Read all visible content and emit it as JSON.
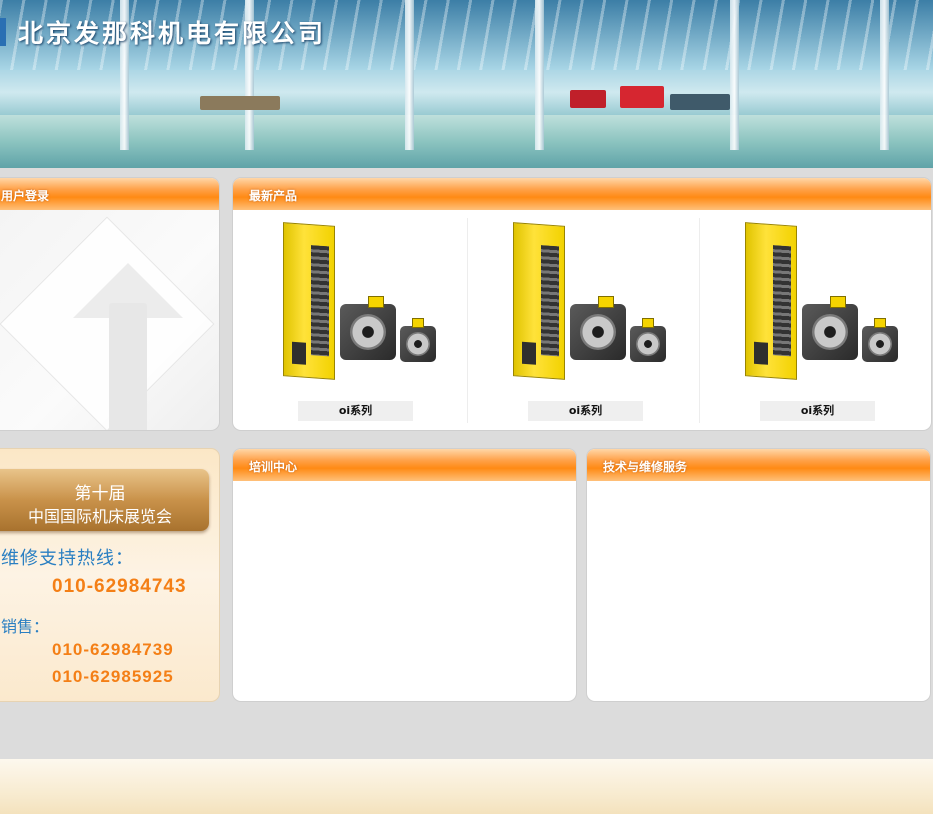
{
  "banner": {
    "company_name": "北京发那科机电有限公司"
  },
  "login_panel": {
    "title": "用户登录"
  },
  "products_panel": {
    "title": "最新产品",
    "items": [
      {
        "caption": "oi系列",
        "image": "servo-drive-and-motors"
      },
      {
        "caption": "oi系列",
        "image": "servo-drive-and-motors"
      },
      {
        "caption": "oi系列",
        "image": "servo-drive-and-motors"
      }
    ]
  },
  "contact_panel": {
    "expo_line1": "第十届",
    "expo_line2": "中国国际机床展览会",
    "hotline_label": "维修支持热线：",
    "hotline_number": "010-62984743",
    "sales_label": "销售：",
    "sales_numbers": [
      "010-62984739",
      "010-62985925"
    ]
  },
  "training_panel": {
    "title": "培训中心"
  },
  "service_panel": {
    "title": "技术与维修服务"
  },
  "colors": {
    "header_orange": "#ff8a14",
    "phone_orange": "#f47f16",
    "label_blue": "#2a7fc2",
    "page_bg": "#dcdcdc"
  }
}
